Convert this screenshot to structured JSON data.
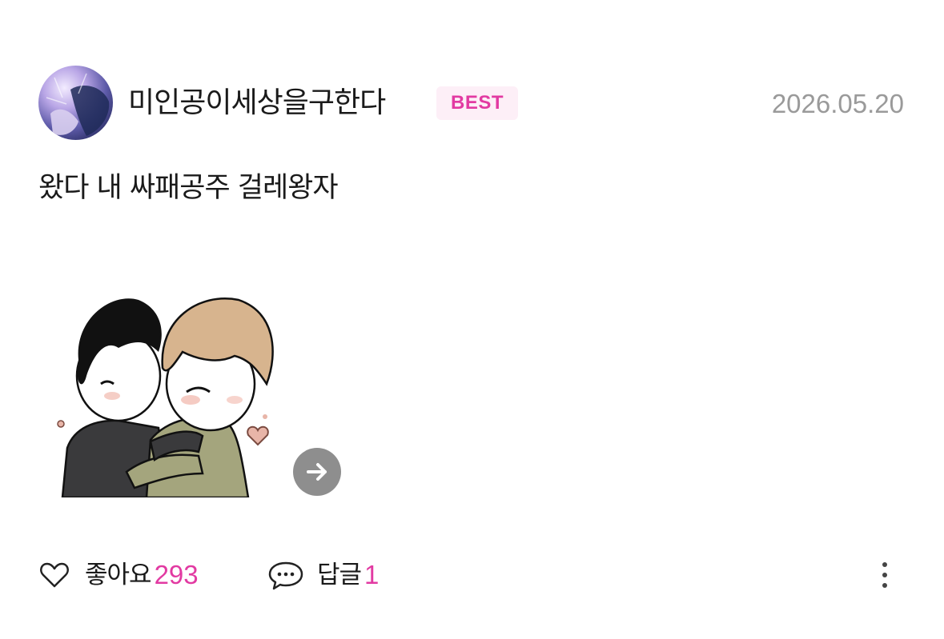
{
  "comment": {
    "author": "미인공이세상을구한다",
    "badge": "BEST",
    "date": "2026.05.20",
    "text": "왔다 내 싸패공주 걸레왕자",
    "sticker_icon": "hugging-couple-sticker",
    "next_icon": "arrow-right-icon"
  },
  "actions": {
    "like_label": "좋아요",
    "like_count": "293",
    "like_icon": "heart-outline-icon",
    "reply_label": "답글",
    "reply_count": "1",
    "reply_icon": "speech-bubble-icon",
    "more_icon": "vertical-ellipsis-icon"
  },
  "colors": {
    "accent": "#e23aa2",
    "badge_bg": "#fdeff7",
    "muted": "#9a9a9a",
    "text": "#1a1a1a",
    "button_gray": "#8e8e8e"
  }
}
